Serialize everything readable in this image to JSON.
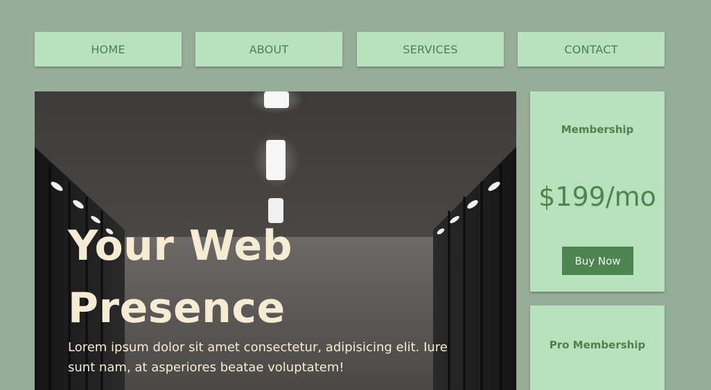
{
  "nav": {
    "items": [
      {
        "label": "HOME"
      },
      {
        "label": "ABOUT"
      },
      {
        "label": "SERVICES"
      },
      {
        "label": "CONTACT"
      }
    ]
  },
  "hero": {
    "title_line1": "Your Web",
    "title_line2": "Presence",
    "text": "Lorem ipsum dolor sit amet consectetur, adipisicing elit. Iure sunt nam, at asperiores beatae voluptatem!",
    "image": "server-room-corridor"
  },
  "pricing": [
    {
      "title": "Membership",
      "price": "$199/mo",
      "button": "Buy Now"
    },
    {
      "title": "Pro Membership"
    }
  ],
  "colors": {
    "page_bg": "#97ad98",
    "card_bg": "#b8e2bb",
    "accent": "#4e8450",
    "hero_text": "#f6ecd4"
  }
}
